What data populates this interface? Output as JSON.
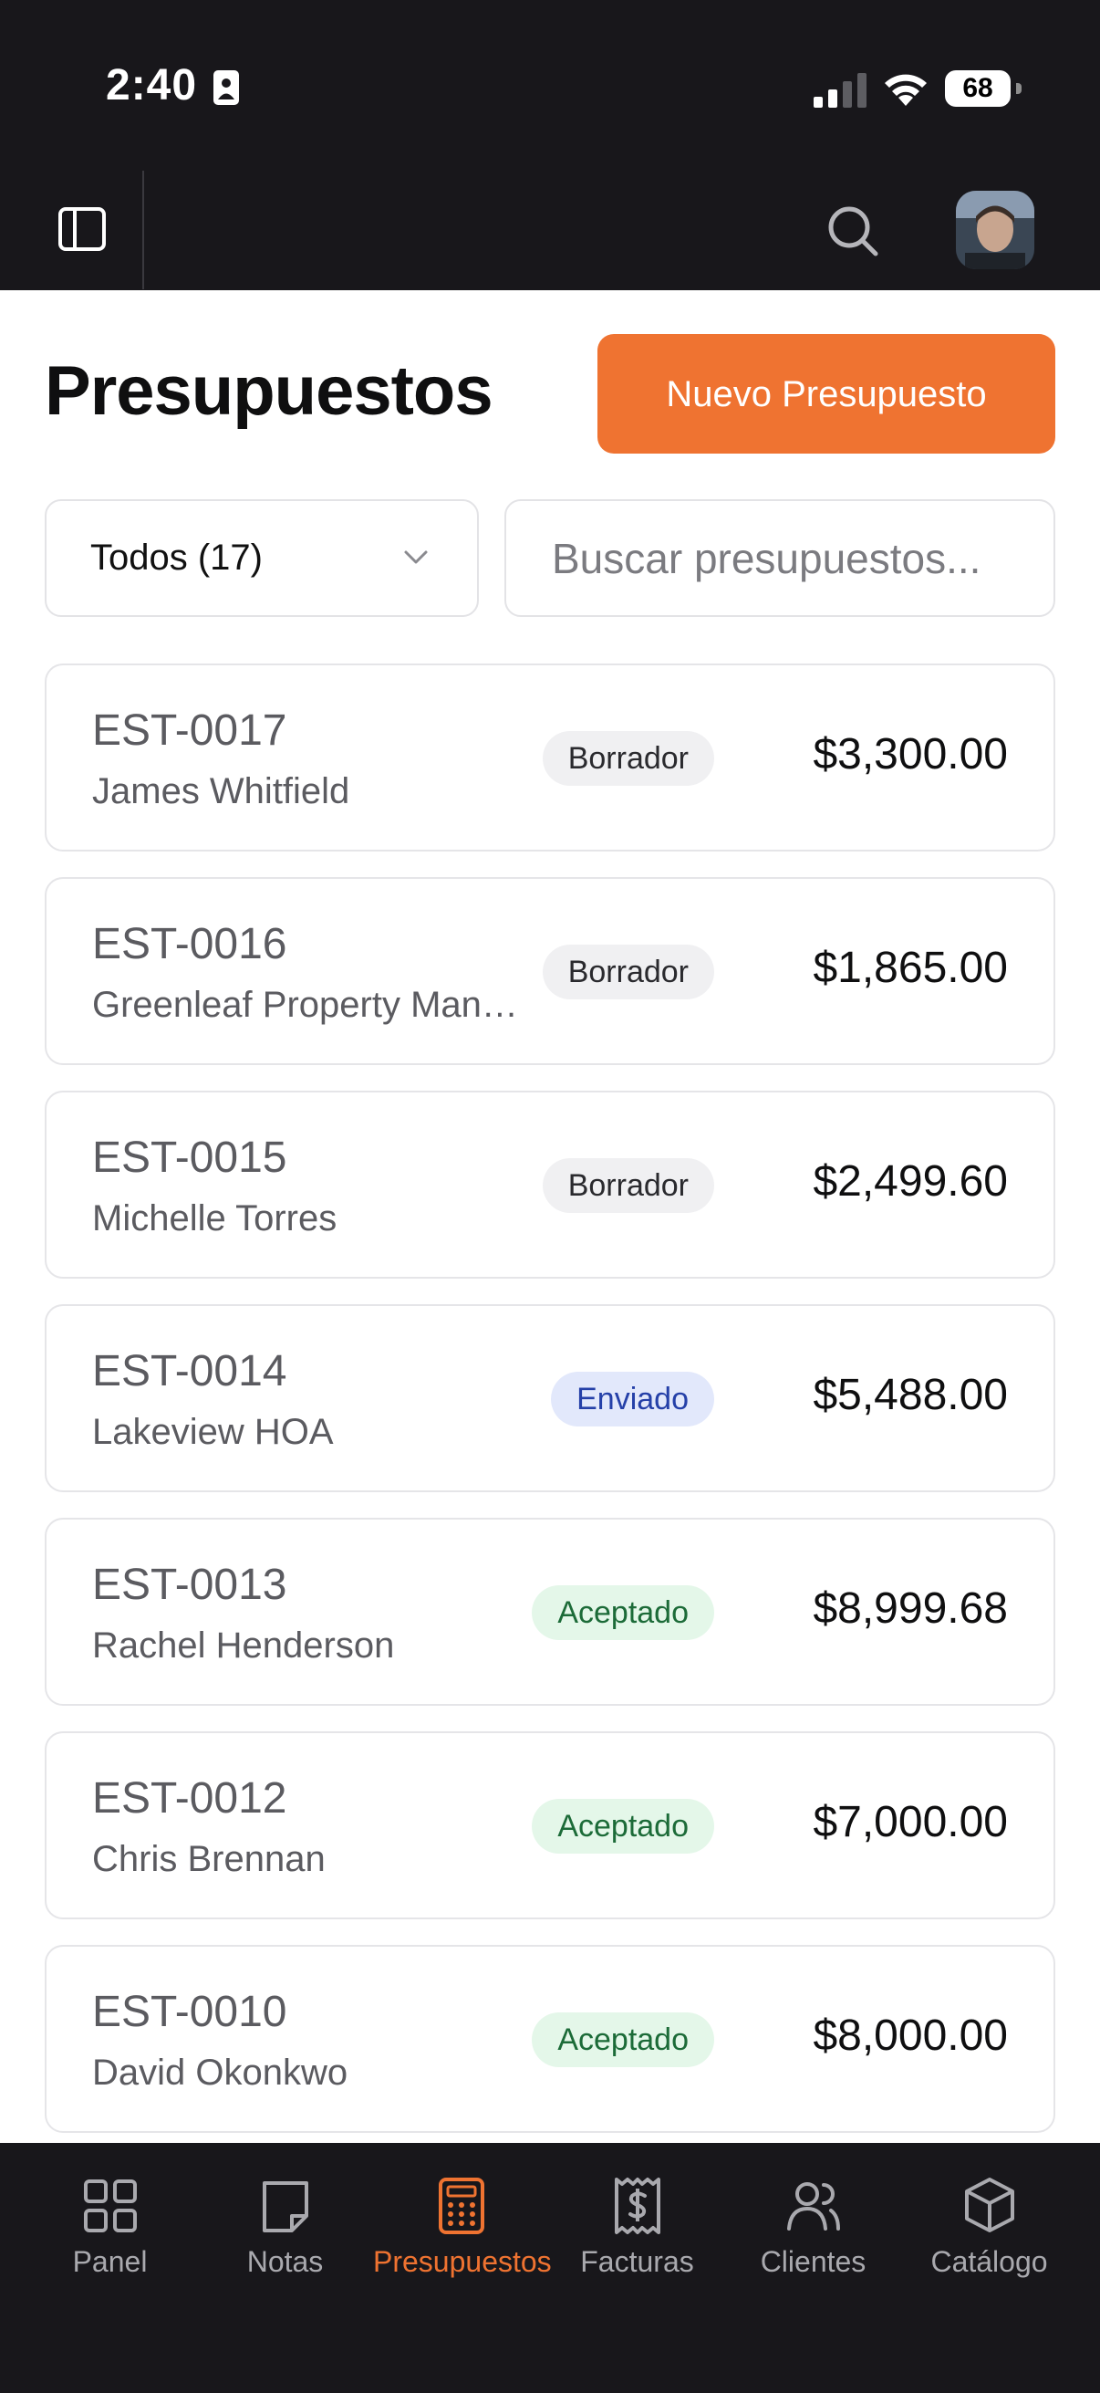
{
  "status_bar": {
    "time": "2:40",
    "battery": "68"
  },
  "header": {
    "avatar_alt": "User avatar"
  },
  "page": {
    "title": "Presupuestos",
    "new_button": "Nuevo Presupuesto"
  },
  "filter": {
    "selected": "Todos (17)"
  },
  "search": {
    "placeholder": "Buscar presupuestos..."
  },
  "estimates": [
    {
      "id": "EST-0017",
      "client": "James Whitfield",
      "status": "Borrador",
      "status_type": "draft",
      "amount": "$3,300.00"
    },
    {
      "id": "EST-0016",
      "client": "Greenleaf Property Man…",
      "status": "Borrador",
      "status_type": "draft",
      "amount": "$1,865.00"
    },
    {
      "id": "EST-0015",
      "client": "Michelle Torres",
      "status": "Borrador",
      "status_type": "draft",
      "amount": "$2,499.60"
    },
    {
      "id": "EST-0014",
      "client": "Lakeview HOA",
      "status": "Enviado",
      "status_type": "sent",
      "amount": "$5,488.00"
    },
    {
      "id": "EST-0013",
      "client": "Rachel Henderson",
      "status": "Aceptado",
      "status_type": "accepted",
      "amount": "$8,999.68"
    },
    {
      "id": "EST-0012",
      "client": "Chris Brennan",
      "status": "Aceptado",
      "status_type": "accepted",
      "amount": "$7,000.00"
    },
    {
      "id": "EST-0010",
      "client": "David Okonkwo",
      "status": "Aceptado",
      "status_type": "accepted",
      "amount": "$8,000.00"
    }
  ],
  "bottom_nav": [
    {
      "label": "Panel",
      "icon": "grid-icon",
      "active": false
    },
    {
      "label": "Notas",
      "icon": "note-icon",
      "active": false
    },
    {
      "label": "Presupuestos",
      "icon": "calculator-icon",
      "active": true
    },
    {
      "label": "Facturas",
      "icon": "receipt-icon",
      "active": false
    },
    {
      "label": "Clientes",
      "icon": "users-icon",
      "active": false
    },
    {
      "label": "Catálogo",
      "icon": "box-icon",
      "active": false
    }
  ],
  "colors": {
    "accent": "#ef7331",
    "dark_bg": "#18171b"
  }
}
